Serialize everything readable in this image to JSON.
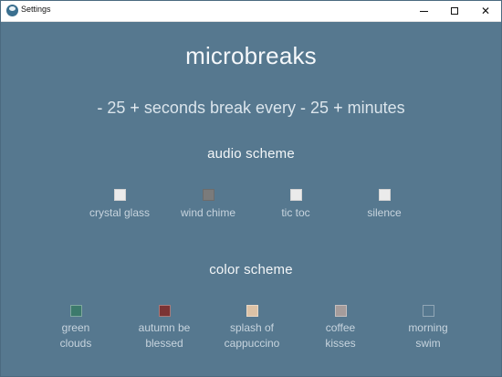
{
  "window": {
    "title": "Settings",
    "icon": "app-icon",
    "controls": {
      "minimize_icon": "minimize-icon",
      "maximize_icon": "maximize-icon",
      "close_icon": "close-icon",
      "close_glyph": "✕"
    }
  },
  "app": {
    "title": "microbreaks"
  },
  "break_settings": {
    "seconds": {
      "decrement": "-",
      "value": "25",
      "increment": "+",
      "unit": "seconds break every"
    },
    "minutes": {
      "decrement": "-",
      "value": "25",
      "increment": "+",
      "unit": "minutes"
    }
  },
  "audio_scheme": {
    "heading": "audio scheme",
    "options": [
      {
        "label": "crystal glass",
        "selected": false
      },
      {
        "label": "wind chime",
        "selected": true
      },
      {
        "label": "tic toc",
        "selected": false
      },
      {
        "label": "silence",
        "selected": false
      }
    ]
  },
  "color_scheme": {
    "heading": "color scheme",
    "options": [
      {
        "label_line1": "green",
        "label_line2": "clouds",
        "color": "#3c7a6c"
      },
      {
        "label_line1": "autumn be",
        "label_line2": "blessed",
        "color": "#7b3334"
      },
      {
        "label_line1": "splash of",
        "label_line2": "cappuccino",
        "color": "#dcc2a6"
      },
      {
        "label_line1": "coffee",
        "label_line2": "kisses",
        "color": "#a59c9b"
      },
      {
        "label_line1": "morning",
        "label_line2": "swim",
        "color": "#56788f"
      }
    ]
  },
  "colors": {
    "background": "#56788f",
    "text": "#ffffff",
    "muted_text": "#c7d4de"
  }
}
